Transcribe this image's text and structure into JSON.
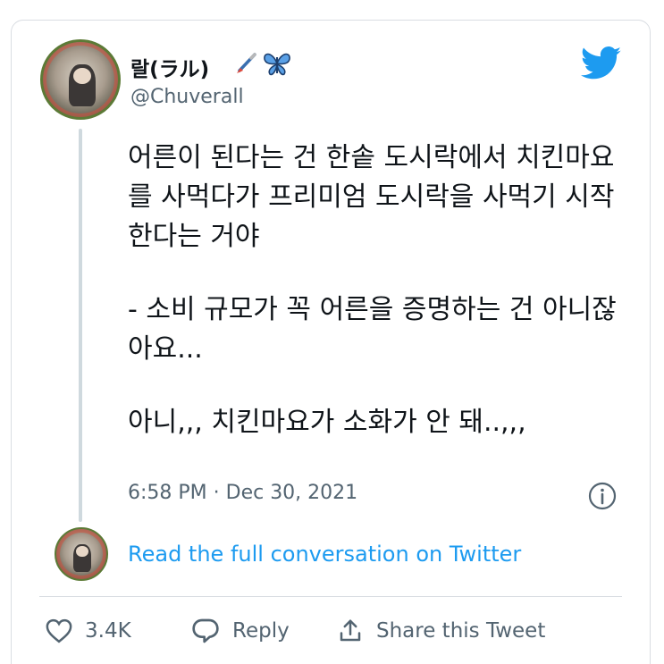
{
  "tweet": {
    "author": {
      "display_name": "랄(ラル)",
      "name_emojis": [
        "paintbrush-emoji",
        "butterfly-emoji"
      ],
      "handle": "@Chuverall"
    },
    "text_paragraphs": [
      "어른이 된다는 건 한솥 도시락에서 치킨마요를 사먹다가 프리미엄 도시락을 사먹기 시작한다는 거야",
      "- 소비 규모가 꼭 어른을 증명하는 건 아니잖아요...",
      "아니,,, 치킨마요가 소화가 안 돼..,,,"
    ],
    "timestamp": "6:58 PM · Dec 30, 2021",
    "read_full_link": "Read the full conversation on Twitter",
    "actions": {
      "like_count": "3.4K",
      "reply_label": "Reply",
      "share_label": "Share this Tweet"
    }
  },
  "colors": {
    "link_blue": "#1d9bf0",
    "secondary_text": "#536471",
    "primary_text": "#0f1419",
    "divider": "#d9dde2"
  }
}
